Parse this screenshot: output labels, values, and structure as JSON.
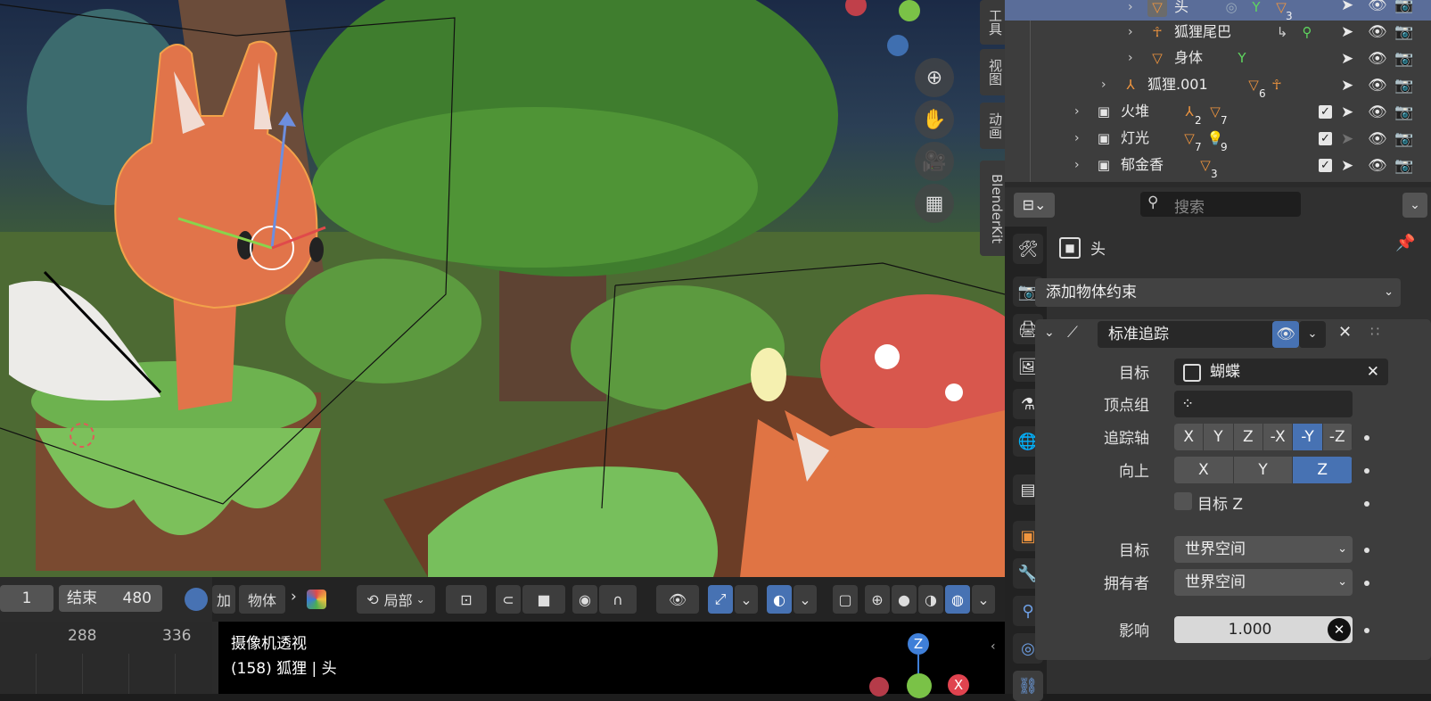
{
  "sidebar_tabs": [
    "工具",
    "视图",
    "动画",
    "BlenderKit"
  ],
  "outliner": {
    "rows": [
      {
        "label": "头",
        "selected": true,
        "icon": "mesh-icon",
        "badges": [
          "3"
        ]
      },
      {
        "label": "狐狸尾巴",
        "selected": false,
        "icon": "armature-icon"
      },
      {
        "label": "身体",
        "selected": false,
        "icon": "mesh-icon"
      },
      {
        "label": "狐狸.001",
        "selected": false,
        "icon": "armature-object-icon",
        "badges": [
          "6"
        ]
      },
      {
        "label": "火堆",
        "selected": false,
        "icon": "collection-icon",
        "badges": [
          "2",
          "7"
        ]
      },
      {
        "label": "灯光",
        "selected": false,
        "icon": "collection-icon",
        "badges": [
          "7",
          "9"
        ]
      },
      {
        "label": "郁金香",
        "selected": false,
        "icon": "collection-icon",
        "badges": [
          "3"
        ]
      }
    ]
  },
  "timeline": {
    "start_value": "1",
    "end_label": "结束",
    "end_value": "480",
    "ruler": [
      "288",
      "336"
    ]
  },
  "viewport_header": {
    "add_label": "加",
    "object_label": "物体",
    "transform_label": "局部"
  },
  "viewport_overlay": {
    "view_name": "摄像机透视",
    "object_info": "(158) 狐狸 | 头",
    "gizmo_axes": {
      "z": "Z",
      "x": "X"
    }
  },
  "properties": {
    "search_placeholder": "搜索",
    "object_name": "头",
    "add_constraint": "添加物体约束",
    "constraint": {
      "name": "标准追踪",
      "target_label": "目标",
      "target_value": "蝴蝶",
      "vertex_group_label": "顶点组",
      "track_axis_label": "追踪轴",
      "track_axis_options": [
        "X",
        "Y",
        "Z",
        "-X",
        "-Y",
        "-Z"
      ],
      "track_axis_selected": "-Y",
      "up_label": "向上",
      "up_options": [
        "X",
        "Y",
        "Z"
      ],
      "up_selected": "Z",
      "target_z_label": "目标 Z",
      "target_space_label": "目标",
      "target_space_value": "世界空间",
      "owner_space_label": "拥有者",
      "owner_space_value": "世界空间",
      "influence_label": "影响",
      "influence_value": "1.000"
    }
  }
}
